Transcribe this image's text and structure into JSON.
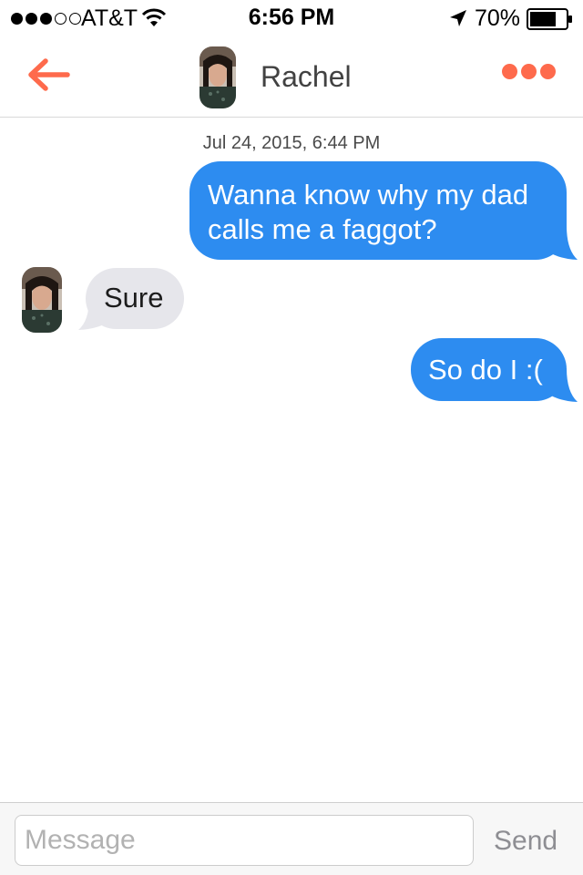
{
  "status_bar": {
    "carrier": "AT&T",
    "time": "6:56 PM",
    "battery_percent": "70%",
    "signal_bars": 3,
    "signal_max": 5,
    "battery_level": 0.7
  },
  "header": {
    "title": "Rachel",
    "back_icon": "back-arrow-icon",
    "more_icon": "more-dots-icon",
    "accent_color": "#fe6a4c"
  },
  "conversation": {
    "timestamp": "Jul 24, 2015, 6:44 PM",
    "messages": [
      {
        "direction": "outgoing",
        "text_line1": "Wanna know why my dad",
        "text_line2": "calls me a faggot?"
      },
      {
        "direction": "incoming",
        "text": "Sure"
      },
      {
        "direction": "outgoing",
        "text": "So do I :("
      }
    ],
    "outgoing_color": "#2d8cf0",
    "incoming_color": "#e6e6eb"
  },
  "composer": {
    "placeholder": "Message",
    "value": "",
    "send_label": "Send"
  }
}
